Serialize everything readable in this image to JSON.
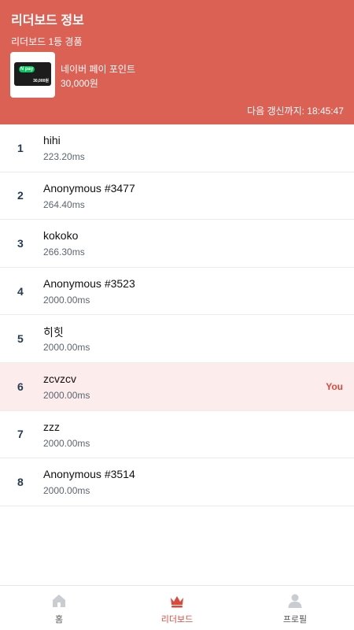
{
  "header": {
    "title": "리더보드 정보",
    "subtitle": "리더보드 1등 경품",
    "prize_name": "네이버 페이 포인트",
    "prize_value": "30,000원",
    "card_logo": "N pay",
    "card_amount": "30,000원",
    "refresh_label": "다음 갱신까지: 18:45:47"
  },
  "leaderboard": [
    {
      "rank": "1",
      "name": "hihi",
      "time": "223.20ms",
      "badge": ""
    },
    {
      "rank": "2",
      "name": "Anonymous #3477",
      "time": "264.40ms",
      "badge": ""
    },
    {
      "rank": "3",
      "name": "kokoko",
      "time": "266.30ms",
      "badge": ""
    },
    {
      "rank": "4",
      "name": "Anonymous #3523",
      "time": "2000.00ms",
      "badge": ""
    },
    {
      "rank": "5",
      "name": "히힛",
      "time": "2000.00ms",
      "badge": ""
    },
    {
      "rank": "6",
      "name": "zcvzcv",
      "time": "2000.00ms",
      "badge": "You"
    },
    {
      "rank": "7",
      "name": "zzz",
      "time": "2000.00ms",
      "badge": ""
    },
    {
      "rank": "8",
      "name": "Anonymous #3514",
      "time": "2000.00ms",
      "badge": ""
    }
  ],
  "tabs": [
    {
      "label": "홈",
      "icon": "home-icon",
      "active": false
    },
    {
      "label": "리더보드",
      "icon": "crown-icon",
      "active": true
    },
    {
      "label": "프로필",
      "icon": "profile-icon",
      "active": false
    }
  ],
  "colors": {
    "accent": "#dc6155",
    "highlight_row": "#fcecec",
    "you_text": "#d94a3d"
  }
}
